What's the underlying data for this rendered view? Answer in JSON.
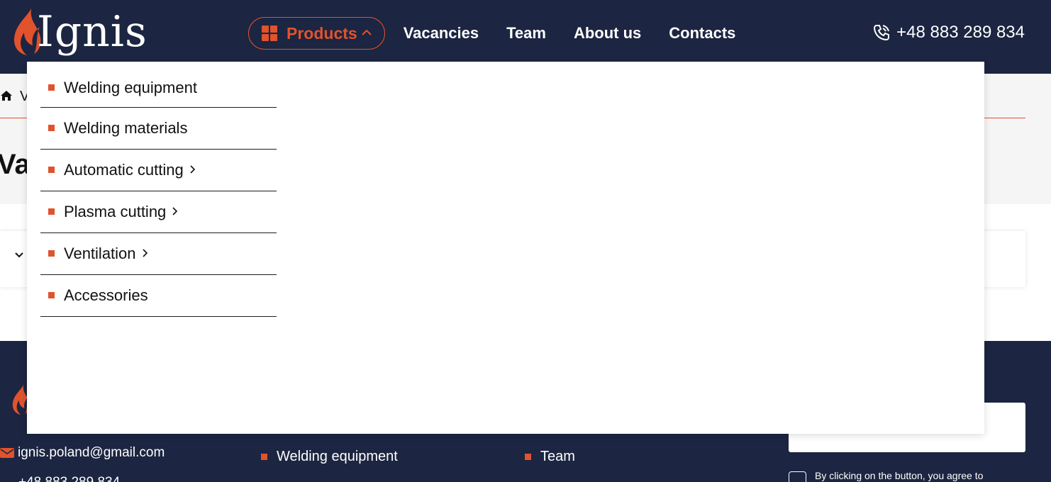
{
  "header": {
    "logo_text": "Ignis",
    "nav": {
      "products_label": "Products",
      "links": [
        "Vacancies",
        "Team",
        "About us",
        "Contacts"
      ]
    },
    "phone": "+48 883 289 834"
  },
  "breadcrumb": {
    "current": "V"
  },
  "page": {
    "title": "Va"
  },
  "products_menu": {
    "items": [
      {
        "label": "Welding equipment",
        "has_submenu": false
      },
      {
        "label": "Welding materials",
        "has_submenu": false
      },
      {
        "label": "Automatic cutting",
        "has_submenu": true
      },
      {
        "label": "Plasma cutting",
        "has_submenu": true
      },
      {
        "label": "Ventilation",
        "has_submenu": true
      },
      {
        "label": "Accessories",
        "has_submenu": false
      }
    ]
  },
  "footer": {
    "email": "ignis.poland@gmail.com",
    "phone_partial": "+48 883 289 834",
    "products_first": "Welding equipment",
    "company_first": "Team",
    "consent_text": "By clicking on the button, you agree to"
  },
  "colors": {
    "navy": "#1c2541",
    "accent": "#e0532d"
  }
}
